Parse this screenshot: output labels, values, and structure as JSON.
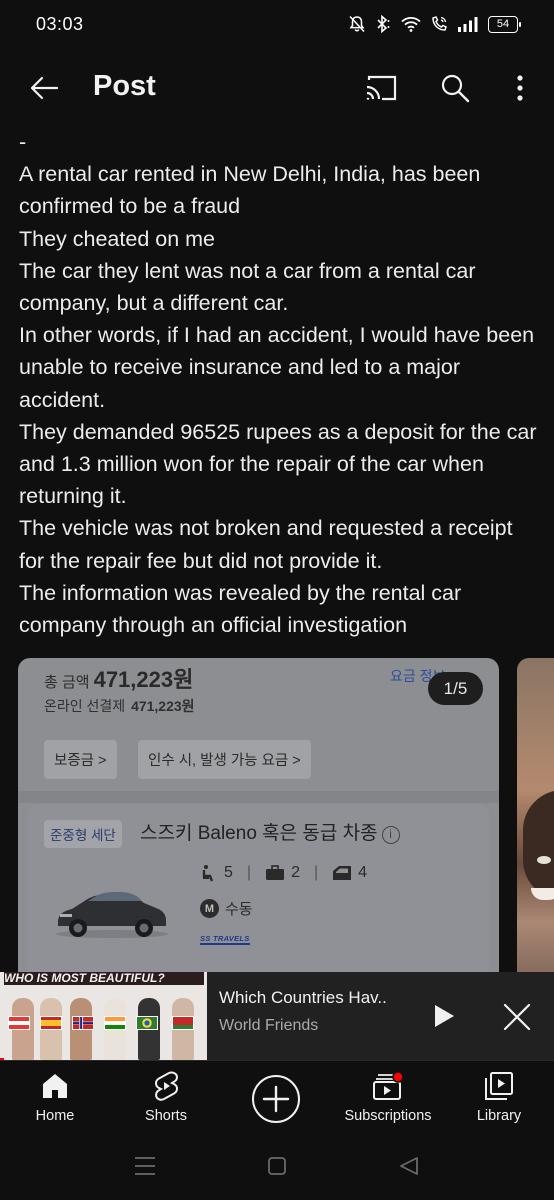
{
  "status_bar": {
    "time": "03:03",
    "battery": "54",
    "icons": [
      "mute-bell-icon",
      "bluetooth-icon",
      "wifi-icon",
      "wifi-calling-icon",
      "signal-icon",
      "battery-icon"
    ]
  },
  "header": {
    "title": "Post",
    "back_icon": "arrow-left-icon",
    "actions": [
      "cast-icon",
      "search-icon",
      "more-vert-icon"
    ]
  },
  "post": {
    "paragraphs": [
      "-",
      "A rental car rented in New Delhi, India, has been confirmed to be a fraud",
      "They cheated on me",
      "The car they lent was not a car from a rental car company, but a different car.",
      "In other words, if I had an accident, I would have been unable to receive insurance and led to a major accident.",
      "They demanded 96525 rupees as a deposit for the car and 1.3 million won for the repair of the car when returning it.",
      "The vehicle was not broken and requested a receipt for the repair fee but did not provide it.",
      "The information was revealed by the rental car company through an official investigation"
    ]
  },
  "carousel": {
    "counter": "1/5",
    "image1": {
      "total_label": "총 금액",
      "total_value": "471,223원",
      "link": "요금 정보 >",
      "online_label": "온라인 선결제",
      "online_value": "471,223원",
      "chip_deposit": "보증금 >",
      "chip_fees": "인수 시, 발생 가능 요금 >",
      "car_type": "준중형 세단",
      "car_name": "스즈키 Baleno 혹은 동급 차종",
      "info": "i",
      "seats": "5",
      "bags": "2",
      "doors": "4",
      "m_badge": "M",
      "transmission": "수동",
      "logo": "SS TRAVELS"
    }
  },
  "mini_player": {
    "thumb_title": "WHO IS MOST BEAUTIFUL?",
    "title": "Which Countries Hav..",
    "channel": "World Friends"
  },
  "bottom_nav": {
    "items": [
      {
        "label": "Home",
        "icon": "home-icon"
      },
      {
        "label": "Shorts",
        "icon": "shorts-icon"
      },
      {
        "label": "",
        "icon": "create-plus-icon"
      },
      {
        "label": "Subscriptions",
        "icon": "subscriptions-icon"
      },
      {
        "label": "Library",
        "icon": "library-icon"
      }
    ]
  },
  "colors": {
    "background": "#0f0f0f",
    "text": "#f1f1f1",
    "secondary_text": "#aaaaaa",
    "accent_red": "#ff0000",
    "mini_player_bg": "#212121"
  }
}
